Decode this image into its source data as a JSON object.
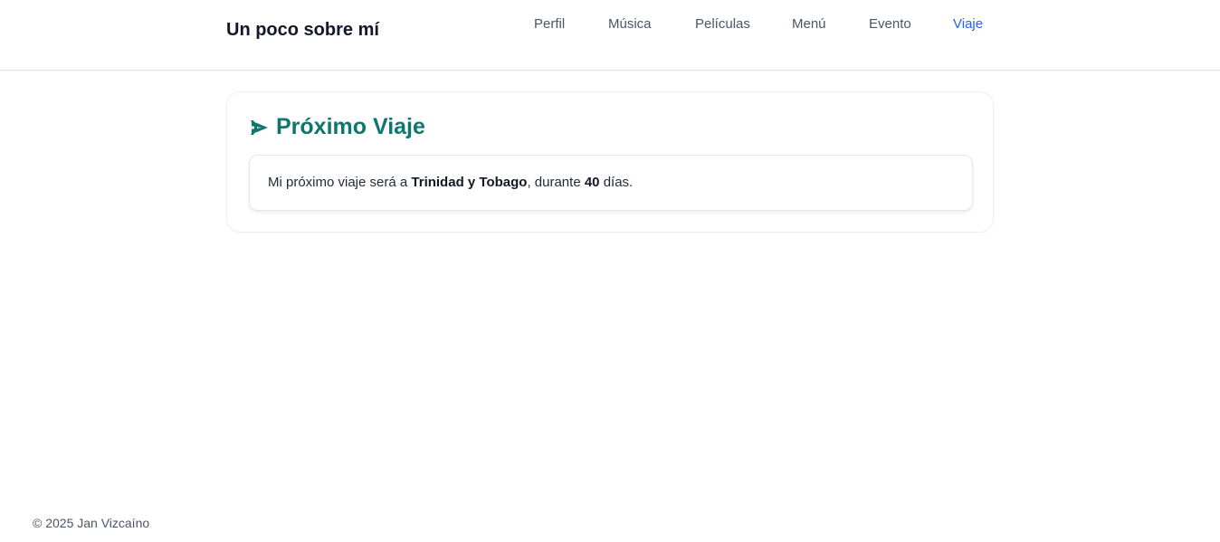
{
  "header": {
    "site_title": "Un poco sobre mí",
    "nav": [
      {
        "label": "Perfil",
        "active": false
      },
      {
        "label": "Música",
        "active": false
      },
      {
        "label": "Películas",
        "active": false
      },
      {
        "label": "Menú",
        "active": false
      },
      {
        "label": "Evento",
        "active": false
      },
      {
        "label": "Viaje",
        "active": true
      }
    ]
  },
  "main": {
    "card_icon": "airplane-icon",
    "card_title": "Próximo Viaje",
    "trip": {
      "prefix": "Mi próximo viaje será a ",
      "destination": "Trinidad y Tobago",
      "middle": ", durante ",
      "days": "40",
      "suffix": " días."
    }
  },
  "footer": {
    "copyright": "© 2025 Jan Vizcaíno"
  },
  "colors": {
    "accent": "#0f766e",
    "active_nav": "#2563eb",
    "nav_text": "#4b5563"
  }
}
